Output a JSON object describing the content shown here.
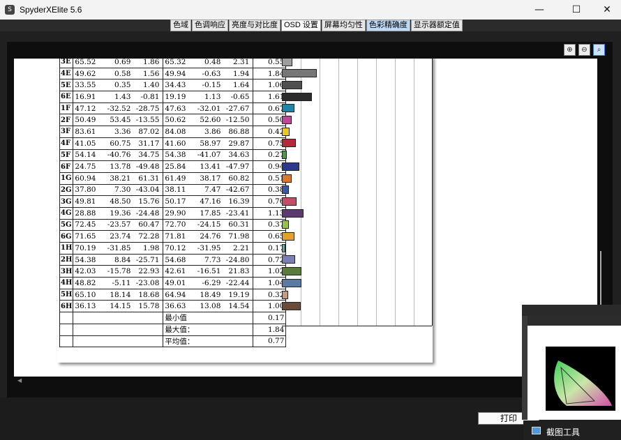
{
  "window": {
    "title": "SpyderXElite 5.6"
  },
  "tabs": [
    {
      "label": "色域",
      "state": "normal"
    },
    {
      "label": "色调响应",
      "state": "normal"
    },
    {
      "label": "亮度与对比度",
      "state": "normal"
    },
    {
      "label": "OSD 设置",
      "state": "active"
    },
    {
      "label": "屏幕均匀性",
      "state": "normal"
    },
    {
      "label": "色彩精确度",
      "state": "highlight"
    },
    {
      "label": "显示器额定值",
      "state": "normal"
    }
  ],
  "zoom": {
    "zoom_in": "zoom-in-icon",
    "zoom_out": "zoom-out-icon",
    "zoom_fit": "zoom-fit-icon"
  },
  "table": {
    "rows": [
      {
        "id": "3E",
        "a": [
          "65.52",
          "0.69",
          "1.86"
        ],
        "b": [
          "65.32",
          "0.48",
          "2.31"
        ],
        "de": "0.55",
        "color": "#9e9e9e"
      },
      {
        "id": "4E",
        "a": [
          "49.62",
          "0.58",
          "1.56"
        ],
        "b": [
          "49.94",
          "-0.63",
          "1.94"
        ],
        "de": "1.84",
        "color": "#777777"
      },
      {
        "id": "5E",
        "a": [
          "33.55",
          "0.35",
          "1.40"
        ],
        "b": [
          "34.43",
          "-0.15",
          "1.64"
        ],
        "de": "1.06",
        "color": "#505050"
      },
      {
        "id": "6E",
        "a": [
          "16.91",
          "1.43",
          "-0.81"
        ],
        "b": [
          "19.19",
          "1.13",
          "-0.65"
        ],
        "de": "1.61",
        "color": "#2c2c2c"
      },
      {
        "id": "1F",
        "a": [
          "47.12",
          "-32.52",
          "-28.75"
        ],
        "b": [
          "47.63",
          "-32.01",
          "-27.67"
        ],
        "de": "0.67",
        "color": "#1e86a8"
      },
      {
        "id": "2F",
        "a": [
          "50.49",
          "53.45",
          "-13.55"
        ],
        "b": [
          "50.62",
          "52.60",
          "-12.50"
        ],
        "de": "0.50",
        "color": "#c0469a"
      },
      {
        "id": "3F",
        "a": [
          "83.61",
          "3.36",
          "87.02"
        ],
        "b": [
          "84.08",
          "3.86",
          "86.88"
        ],
        "de": "0.42",
        "color": "#e8c62c"
      },
      {
        "id": "4F",
        "a": [
          "41.05",
          "60.75",
          "31.17"
        ],
        "b": [
          "41.60",
          "58.97",
          "29.87"
        ],
        "de": "0.75",
        "color": "#b3283a"
      },
      {
        "id": "5F",
        "a": [
          "54.14",
          "-40.76",
          "34.75"
        ],
        "b": [
          "54.38",
          "-41.07",
          "34.63"
        ],
        "de": "0.27",
        "color": "#4a9a44"
      },
      {
        "id": "6F",
        "a": [
          "24.75",
          "13.78",
          "-49.48"
        ],
        "b": [
          "25.84",
          "13.41",
          "-47.97"
        ],
        "de": "0.94",
        "color": "#2c3a8e"
      },
      {
        "id": "1G",
        "a": [
          "60.94",
          "38.21",
          "61.31"
        ],
        "b": [
          "61.49",
          "38.17",
          "60.82"
        ],
        "de": "0.51",
        "color": "#d9772a"
      },
      {
        "id": "2G",
        "a": [
          "37.80",
          "7.30",
          "-43.04"
        ],
        "b": [
          "38.11",
          "7.47",
          "-42.67"
        ],
        "de": "0.38",
        "color": "#3b58a8"
      },
      {
        "id": "3G",
        "a": [
          "49.81",
          "48.50",
          "15.76"
        ],
        "b": [
          "50.17",
          "47.16",
          "16.39"
        ],
        "de": "0.76",
        "color": "#c24f66"
      },
      {
        "id": "4G",
        "a": [
          "28.88",
          "19.36",
          "-24.48"
        ],
        "b": [
          "29.90",
          "17.85",
          "-23.41"
        ],
        "de": "1.13",
        "color": "#5a3a70"
      },
      {
        "id": "5G",
        "a": [
          "72.45",
          "-23.57",
          "60.47"
        ],
        "b": [
          "72.70",
          "-24.15",
          "60.31"
        ],
        "de": "0.37",
        "color": "#98c04a"
      },
      {
        "id": "6G",
        "a": [
          "71.65",
          "23.74",
          "72.28"
        ],
        "b": [
          "71.81",
          "24.76",
          "71.98"
        ],
        "de": "0.65",
        "color": "#e5a02c"
      },
      {
        "id": "1H",
        "a": [
          "70.19",
          "-31.85",
          "1.98"
        ],
        "b": [
          "70.12",
          "-31.95",
          "2.21"
        ],
        "de": "0.17",
        "color": "#5ab0a0"
      },
      {
        "id": "2H",
        "a": [
          "54.38",
          "8.84",
          "-25.71"
        ],
        "b": [
          "54.68",
          "7.73",
          "-24.80"
        ],
        "de": "0.72",
        "color": "#7a7fb6"
      },
      {
        "id": "3H",
        "a": [
          "42.03",
          "-15.78",
          "22.93"
        ],
        "b": [
          "42.61",
          "-16.51",
          "21.83"
        ],
        "de": "1.02",
        "color": "#5a7a3e"
      },
      {
        "id": "4H",
        "a": [
          "48.82",
          "-5.11",
          "-23.08"
        ],
        "b": [
          "49.01",
          "-6.29",
          "-22.44"
        ],
        "de": "1.04",
        "color": "#5a7aa2"
      },
      {
        "id": "5H",
        "a": [
          "65.10",
          "18.14",
          "18.68"
        ],
        "b": [
          "64.94",
          "18.49",
          "19.19"
        ],
        "de": "0.32",
        "color": "#c49a84"
      },
      {
        "id": "6H",
        "a": [
          "36.13",
          "14.15",
          "15.78"
        ],
        "b": [
          "36.63",
          "13.08",
          "14.54"
        ],
        "de": "1.00",
        "color": "#6a4c3c"
      }
    ],
    "summary": [
      {
        "label": "最小值",
        "value": "0.17"
      },
      {
        "label": "最大值：",
        "value": "1.84"
      },
      {
        "label": "平均值：",
        "value": "0.77"
      }
    ]
  },
  "buttons": {
    "print": "打印"
  },
  "taskbar": {
    "label": "截图工具"
  }
}
